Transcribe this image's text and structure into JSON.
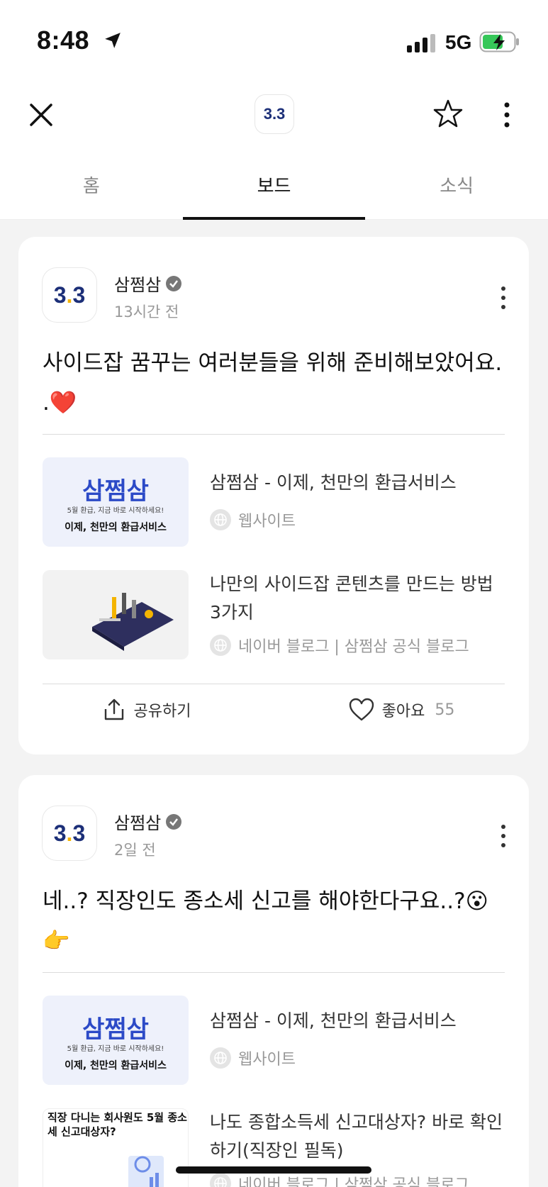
{
  "status_bar": {
    "time": "8:48",
    "network": "5G",
    "icons": [
      "location-icon",
      "signal-icon",
      "battery-charging-icon"
    ]
  },
  "header": {
    "logo_text": "3.3",
    "tabs": [
      {
        "label": "홈"
      },
      {
        "label": "보드",
        "active": true
      },
      {
        "label": "소식"
      }
    ]
  },
  "posts": [
    {
      "author": "삼쩜삼",
      "time_ago": "13시간 전",
      "text_line1": "사이드잡 꿈꾸는 여러분들을 위해 준비해보았어요.",
      "text_line2": ".❤️",
      "links": [
        {
          "title": "삼쩜삼 - 이제, 천만의 환급서비스",
          "source": "웹사이트",
          "thumb_big": "삼쩜삼",
          "thumb_small": "5월 환급, 지금 바로 시작하세요!",
          "thumb_bottom": "이제, 천만의 환급서비스"
        },
        {
          "title": "나만의 사이드잡 콘텐츠를 만드는 방법 3가지",
          "source": "네이버 블로그 | 삼쩜삼 공식 블로그"
        }
      ],
      "actions": {
        "share": "공유하기",
        "like": "좋아요",
        "like_count": "55"
      }
    },
    {
      "author": "삼쩜삼",
      "time_ago": "2일 전",
      "text_line1": "네..? 직장인도 종소세 신고를 해야한다구요..?😮",
      "text_line2": "👉",
      "links": [
        {
          "title": "삼쩜삼 - 이제, 천만의 환급서비스",
          "source": "웹사이트",
          "thumb_big": "삼쩜삼",
          "thumb_small": "5월 환급, 지금 바로 시작하세요!",
          "thumb_bottom": "이제, 천만의 환급서비스"
        },
        {
          "title": "나도 종합소득세 신고대상자? 바로 확인하기(직장인 필독)",
          "source": "네이버 블로그 | 삼쩜삼 공식 블로그",
          "thumb_text": "직장 다니는 회사원도 5월 종소세 신고대상자?"
        }
      ]
    }
  ]
}
